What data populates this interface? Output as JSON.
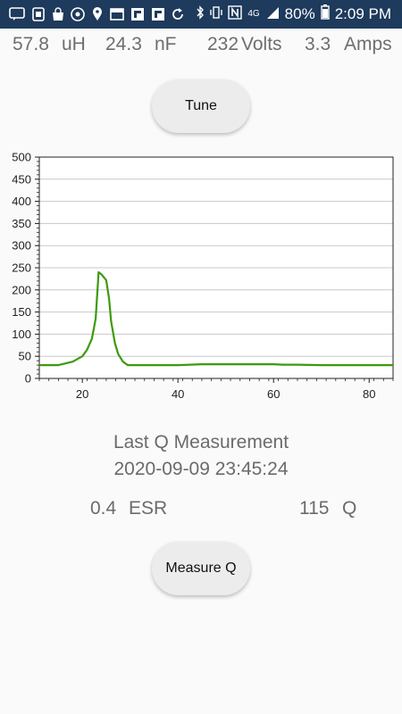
{
  "status_bar": {
    "battery": "80%",
    "time": "2:09 PM",
    "network": "4G",
    "left_icons": [
      "message-icon",
      "screen-mirror-icon",
      "shopping-bag-icon",
      "chrome-icon",
      "location-icon",
      "calendar-icon",
      "flipboard-icon",
      "flipboard-icon",
      "sync-icon"
    ],
    "right_icons": [
      "bluetooth-icon",
      "vibrate-icon",
      "nfc-icon",
      "lte-icon",
      "signal-icon",
      "battery-icon"
    ]
  },
  "readings": {
    "inductance_value": "57.8",
    "inductance_unit": "uH",
    "capacitance_value": "24.3",
    "capacitance_unit": "nF",
    "voltage_value": "232",
    "voltage_unit": "Volts",
    "current_value": "3.3",
    "current_unit": "Amps"
  },
  "buttons": {
    "tune": "Tune",
    "measure_q": "Measure Q"
  },
  "measurement": {
    "heading": "Last Q Measurement",
    "timestamp": "2020-09-09 23:45:24",
    "esr_value": "0.4",
    "esr_label": "ESR",
    "q_value": "115",
    "q_label": "Q"
  },
  "colors": {
    "series": "#3e9a0c",
    "status_bar": "#1e3a5c",
    "grid": "#c8c8c8"
  },
  "chart_data": {
    "type": "line",
    "xlim": [
      11,
      85
    ],
    "ylim": [
      0,
      500
    ],
    "x_ticks": [
      20,
      40,
      60,
      80
    ],
    "y_ticks": [
      0,
      50,
      100,
      150,
      200,
      250,
      300,
      350,
      400,
      450,
      500
    ],
    "grid": true,
    "series": [
      {
        "x": [
          11,
          15,
          18,
          20,
          21,
          22,
          22.8,
          23.4,
          24,
          25,
          25.6,
          26,
          26.8,
          27.5,
          28.5,
          29.5,
          33,
          40,
          45,
          50,
          55,
          60,
          62,
          65,
          70,
          75,
          80,
          85
        ],
        "y": [
          30,
          30,
          38,
          50,
          65,
          90,
          135,
          240,
          235,
          222,
          180,
          130,
          80,
          55,
          38,
          30,
          30,
          30,
          32,
          32,
          32,
          32,
          31,
          31,
          30,
          30,
          30,
          30
        ]
      }
    ]
  }
}
